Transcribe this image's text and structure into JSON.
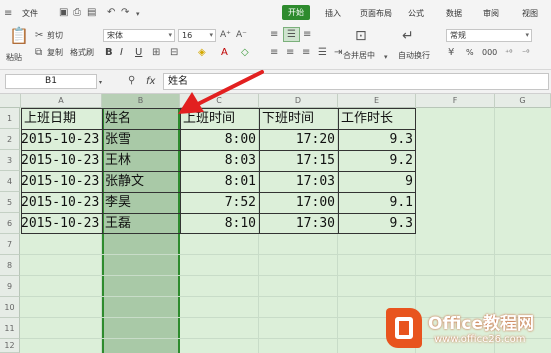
{
  "menubar": {
    "file": "文件",
    "tabs": [
      "开始",
      "插入",
      "页面布局",
      "公式",
      "数据",
      "审阅",
      "视图"
    ],
    "active_tab": "开始"
  },
  "ribbon": {
    "paste": "粘贴",
    "cut": "剪切",
    "copy": "复制",
    "format_painter": "格式刷",
    "font_name": "宋体",
    "font_size": "16",
    "bold": "B",
    "italic": "I",
    "underline": "U",
    "font_color_label": "A",
    "merge_center": "合并居中",
    "wrap_text": "自动换行",
    "number_format": "常规",
    "percent": "%",
    "thousands": "000"
  },
  "formula_bar": {
    "cell_ref": "B1",
    "fx": "fx",
    "value": "姓名"
  },
  "grid": {
    "columns": [
      "A",
      "B",
      "C",
      "D",
      "E",
      "F",
      "G"
    ],
    "rows": [
      "1",
      "2",
      "3",
      "4",
      "5",
      "6",
      "7",
      "8",
      "9",
      "10",
      "11",
      "12"
    ],
    "selected_column": "B",
    "header": [
      "上班日期",
      "姓名",
      "上班时间",
      "下班时间",
      "工作时长"
    ],
    "data": [
      [
        "2015-10-23",
        "张雪",
        "8:00",
        "17:20",
        "9.3"
      ],
      [
        "2015-10-23",
        "王林",
        "8:03",
        "17:15",
        "9.2"
      ],
      [
        "2015-10-23",
        "张静文",
        "8:01",
        "17:03",
        "9"
      ],
      [
        "2015-10-23",
        "李昊",
        "7:52",
        "17:00",
        "9.1"
      ],
      [
        "2015-10-23",
        "王磊",
        "8:10",
        "17:30",
        "9.3"
      ]
    ]
  },
  "watermark": {
    "brand": "Office教程网",
    "url": "www.office26.com"
  },
  "colors": {
    "sheet_bg": "#dcefd9",
    "selection": "#a9c9a7",
    "accent": "#2e8b2e",
    "arrow": "#e22020",
    "logo": "#e8541e"
  }
}
